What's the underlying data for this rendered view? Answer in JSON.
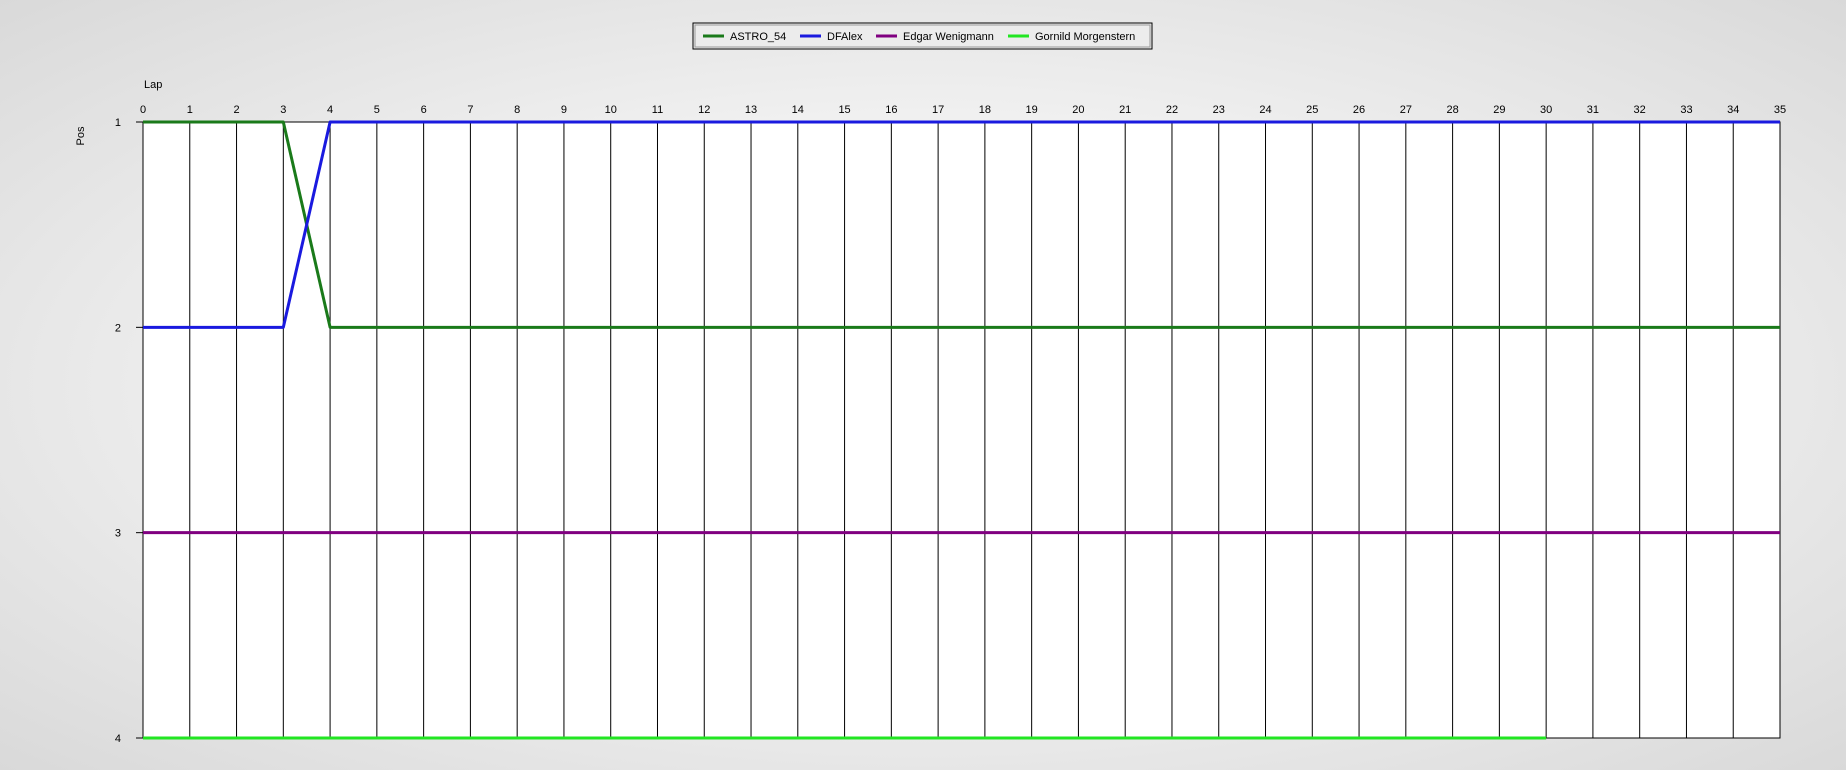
{
  "chart_data": {
    "type": "line",
    "xlabel": "Lap",
    "ylabel": "Pos",
    "x_ticks": [
      0,
      1,
      2,
      3,
      4,
      5,
      6,
      7,
      8,
      9,
      10,
      11,
      12,
      13,
      14,
      15,
      16,
      17,
      18,
      19,
      20,
      21,
      22,
      23,
      24,
      25,
      26,
      27,
      28,
      29,
      30,
      31,
      32,
      33,
      34,
      35
    ],
    "y_ticks": [
      1,
      2,
      3,
      4
    ],
    "xlim": [
      0,
      35
    ],
    "ylim": [
      1,
      4
    ],
    "y_inverted": true,
    "x_axis_position": "top",
    "grid": "vertical",
    "legend_position": "top-center",
    "series": [
      {
        "name": "ASTRO_54",
        "color": "#1a7a1a",
        "x": [
          0,
          1,
          2,
          3,
          4,
          5,
          6,
          7,
          8,
          9,
          10,
          11,
          12,
          13,
          14,
          15,
          16,
          17,
          18,
          19,
          20,
          21,
          22,
          23,
          24,
          25,
          26,
          27,
          28,
          29,
          30,
          31,
          32,
          33,
          34,
          35
        ],
        "y": [
          1,
          1,
          1,
          1,
          2,
          2,
          2,
          2,
          2,
          2,
          2,
          2,
          2,
          2,
          2,
          2,
          2,
          2,
          2,
          2,
          2,
          2,
          2,
          2,
          2,
          2,
          2,
          2,
          2,
          2,
          2,
          2,
          2,
          2,
          2,
          2
        ]
      },
      {
        "name": "DFAlex",
        "color": "#1a1adf",
        "x": [
          0,
          1,
          2,
          3,
          4,
          5,
          6,
          7,
          8,
          9,
          10,
          11,
          12,
          13,
          14,
          15,
          16,
          17,
          18,
          19,
          20,
          21,
          22,
          23,
          24,
          25,
          26,
          27,
          28,
          29,
          30,
          31,
          32,
          33,
          34,
          35
        ],
        "y": [
          2,
          2,
          2,
          2,
          1,
          1,
          1,
          1,
          1,
          1,
          1,
          1,
          1,
          1,
          1,
          1,
          1,
          1,
          1,
          1,
          1,
          1,
          1,
          1,
          1,
          1,
          1,
          1,
          1,
          1,
          1,
          1,
          1,
          1,
          1,
          1
        ]
      },
      {
        "name": "Edgar Wenigmann",
        "color": "#800080",
        "x": [
          0,
          1,
          2,
          3,
          4,
          5,
          6,
          7,
          8,
          9,
          10,
          11,
          12,
          13,
          14,
          15,
          16,
          17,
          18,
          19,
          20,
          21,
          22,
          23,
          24,
          25,
          26,
          27,
          28,
          29,
          30,
          31,
          32,
          33,
          34,
          35
        ],
        "y": [
          3,
          3,
          3,
          3,
          3,
          3,
          3,
          3,
          3,
          3,
          3,
          3,
          3,
          3,
          3,
          3,
          3,
          3,
          3,
          3,
          3,
          3,
          3,
          3,
          3,
          3,
          3,
          3,
          3,
          3,
          3,
          3,
          3,
          3,
          3,
          3
        ]
      },
      {
        "name": "Gornild Morgenstern",
        "color": "#22e622",
        "x": [
          0,
          1,
          2,
          3,
          4,
          5,
          6,
          7,
          8,
          9,
          10,
          11,
          12,
          13,
          14,
          15,
          16,
          17,
          18,
          19,
          20,
          21,
          22,
          23,
          24,
          25,
          26,
          27,
          28,
          29,
          30
        ],
        "y": [
          4,
          4,
          4,
          4,
          4,
          4,
          4,
          4,
          4,
          4,
          4,
          4,
          4,
          4,
          4,
          4,
          4,
          4,
          4,
          4,
          4,
          4,
          4,
          4,
          4,
          4,
          4,
          4,
          4,
          4,
          4
        ]
      }
    ]
  }
}
